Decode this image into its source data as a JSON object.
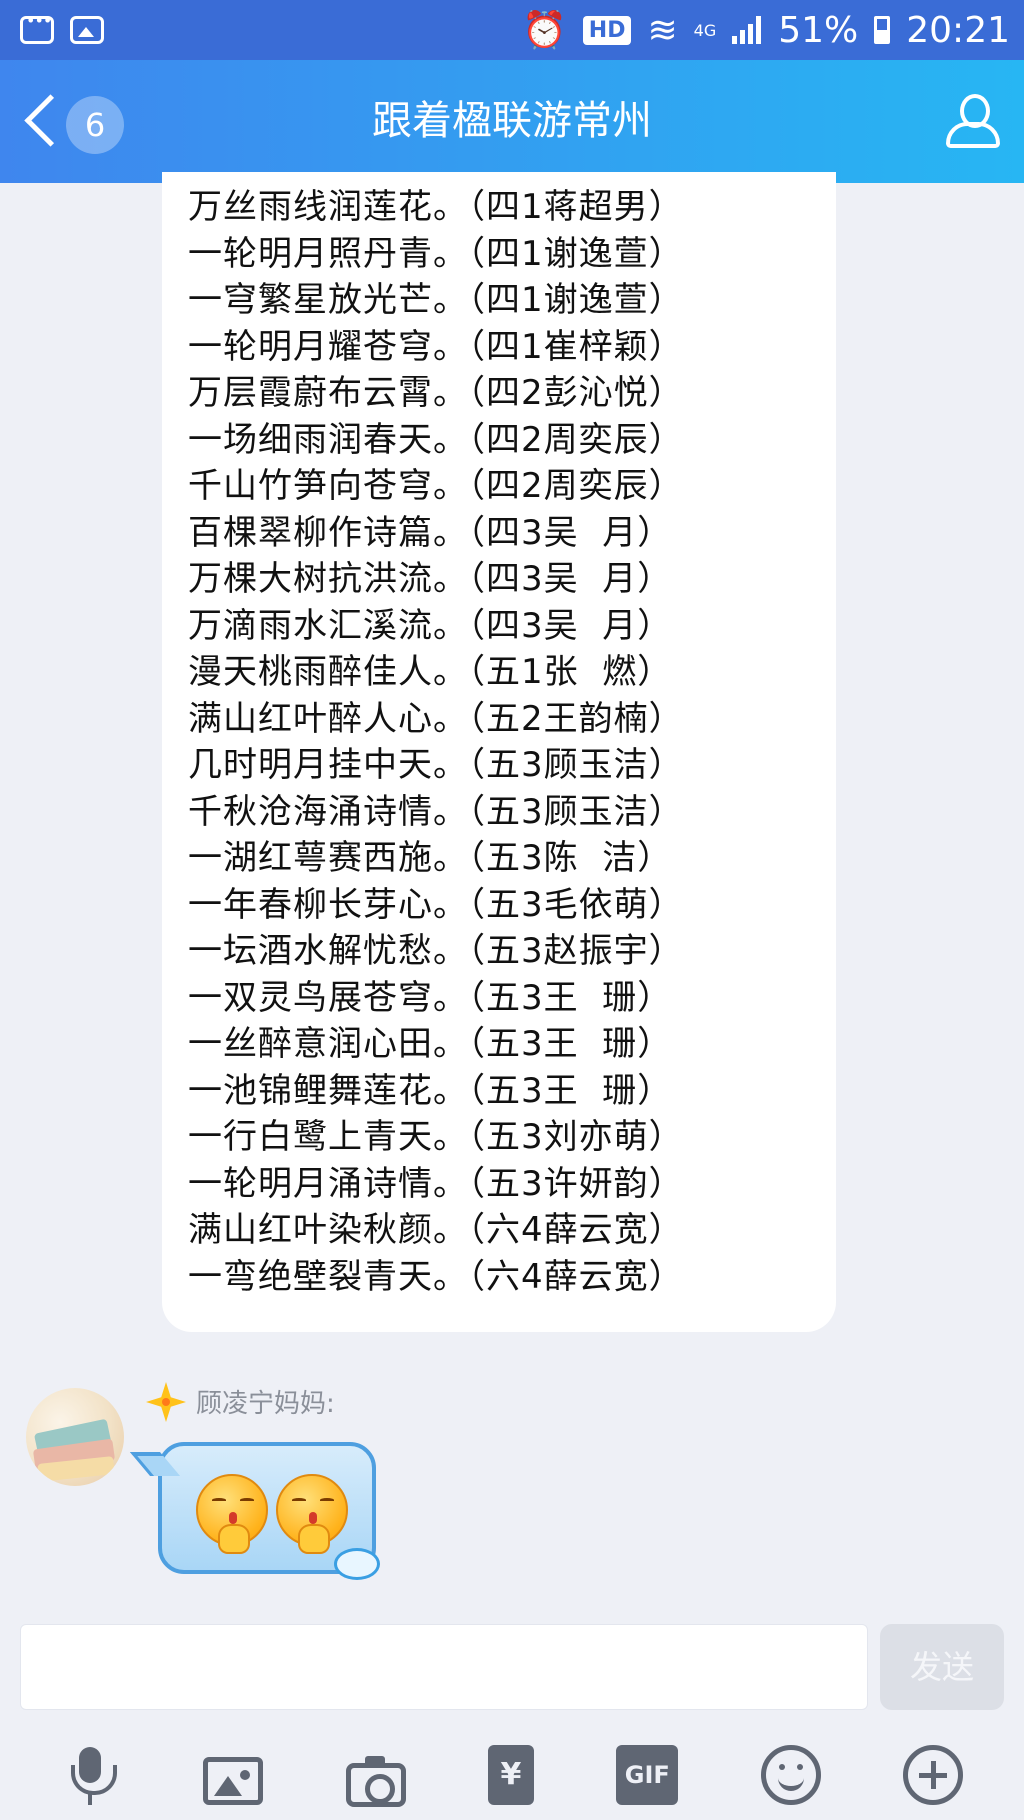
{
  "status_bar": {
    "icons_left": [
      "message-notification-icon",
      "image-notification-icon"
    ],
    "alarm_icon": "alarm-icon",
    "hd_label": "HD",
    "network_label": "4G",
    "battery_percent": "51%",
    "time": "20:21"
  },
  "nav": {
    "unread_count": "6",
    "title": "跟着楹联游常州"
  },
  "message_lines": [
    "万丝雨线润莲花。（四1蒋超男）",
    "一轮明月照丹青。（四1谢逸萱）",
    "一穹繁星放光芒。（四1谢逸萱）",
    "一轮明月耀苍穹。（四1崔梓颖）",
    "万层霞蔚布云霄。（四2彭沁悦）",
    "一场细雨润春天。（四2周奕辰）",
    "千山竹笋向苍穹。（四2周奕辰）",
    "百棵翠柳作诗篇。（四3吴  月）",
    "万棵大树抗洪流。（四3吴  月）",
    "万滴雨水汇溪流。（四3吴  月）",
    "漫天桃雨醉佳人。（五1张  燃）",
    "满山红叶醉人心。（五2王韵楠）",
    "几时明月挂中天。（五3顾玉洁）",
    "千秋沧海涌诗情。（五3顾玉洁）",
    "一湖红萼赛西施。（五3陈  洁）",
    "一年春柳长芽心。（五3毛依萌）",
    "一坛酒水解忧愁。（五3赵振宇）",
    "一双灵鸟展苍穹。（五3王  珊）",
    "一丝醉意润心田。（五3王  珊）",
    "一池锦鲤舞莲花。（五3王  珊）",
    "一行白鹭上青天。（五3刘亦萌）",
    "一轮明月涌诗情。（五3许妍韵）",
    "满山红叶染秋颜。（六4薛云宽）",
    "一弯绝壁裂青天。（六4薛云宽）"
  ],
  "second_message": {
    "sender": "顾凌宁妈妈:",
    "content": "two praying-hands emoji sticker"
  },
  "composer": {
    "input_value": "",
    "send_label": "发送",
    "toolbar": {
      "gif_label": "GIF",
      "red_packet_glyph": "¥"
    }
  },
  "colors": {
    "nav_gradient_start": "#3f86ee",
    "nav_gradient_end": "#27b6f3",
    "background": "#eef0f6",
    "send_disabled": "#dcdfe6"
  }
}
